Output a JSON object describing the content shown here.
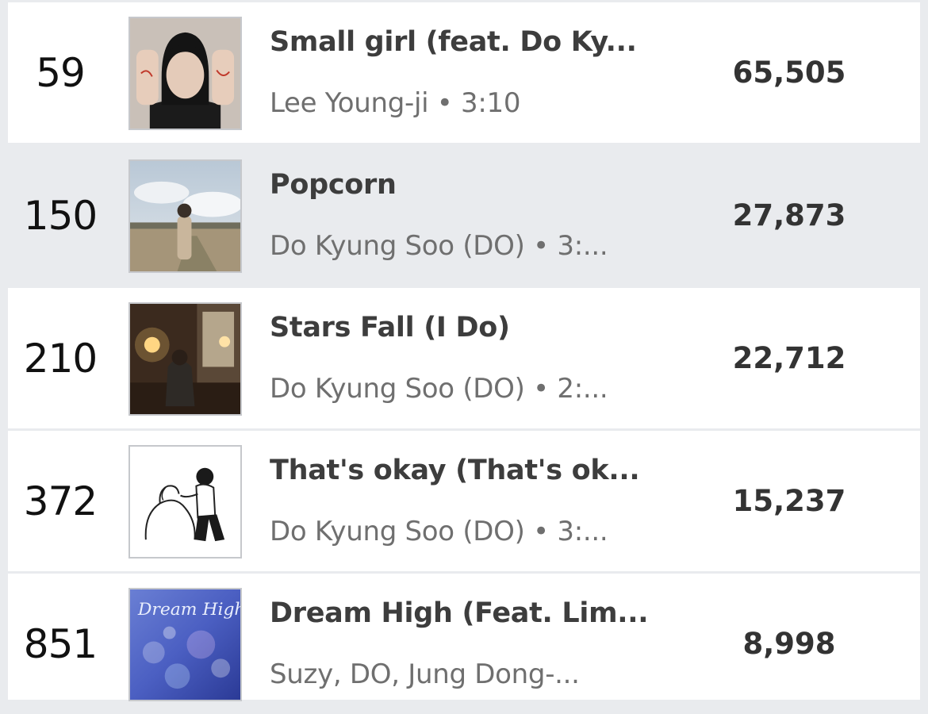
{
  "tracks": [
    {
      "rank": "59",
      "title": "Small girl (feat. Do Ky...",
      "artist_line": "Lee Young-ji • 3:10",
      "plays": "65,505",
      "cover": "artist-portrait-cover"
    },
    {
      "rank": "150",
      "title": "Popcorn",
      "artist_line": "Do Kyung Soo (DO) • 3:...",
      "plays": "27,873",
      "cover": "field-landscape-cover",
      "highlighted": true
    },
    {
      "rank": "210",
      "title": "Stars Fall (I Do)",
      "artist_line": "Do Kyung Soo (DO) • 2:...",
      "plays": "22,712",
      "cover": "lamp-room-cover"
    },
    {
      "rank": "372",
      "title": "That's okay (That's ok...",
      "artist_line": "Do Kyung Soo (DO) • 3:...",
      "plays": "15,237",
      "cover": "dog-illustration-cover"
    },
    {
      "rank": "851",
      "title": "Dream High (Feat. Lim...",
      "artist_line": "Suzy, DO, Jung Dong-...",
      "plays": "8,998",
      "cover": "dream-high-bokeh-cover",
      "cover_text": "Dream High"
    }
  ],
  "colors": {
    "background": "#e9ebee",
    "row": "#ffffff",
    "highlight_row": "#e9ebee",
    "title": "#3d3d3d",
    "subtitle": "#6f6f6f"
  }
}
